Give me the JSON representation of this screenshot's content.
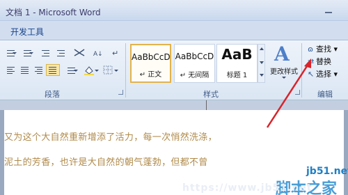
{
  "window": {
    "title": "文档 1 - Microsoft Word"
  },
  "ribbon_tab": "开发工具",
  "paragraph_group": {
    "label": "段落"
  },
  "styles_group": {
    "label": "样式",
    "styles": [
      {
        "sample": "AaBbCcD",
        "name": "↵ 正文"
      },
      {
        "sample": "AaBbCcD",
        "name": "↵ 无间隔"
      },
      {
        "sample": "AaB",
        "name": "标题 1"
      }
    ],
    "change_styles": "更改样式"
  },
  "editing_group": {
    "label": "编辑",
    "find": "查找",
    "replace": "替换",
    "select": "选择"
  },
  "document": {
    "line1": "又为这个大自然重新增添了活力，每一次悄然洗涤，",
    "line2": "泥土的芳香，也许是大自然的朝气蓬勃，但都不曾"
  },
  "watermark": {
    "site": "jb51.net",
    "brand": "脚本之家",
    "url": "https://www.jb51.net"
  }
}
